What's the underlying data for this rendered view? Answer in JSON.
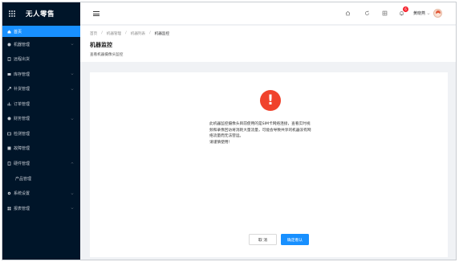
{
  "app": {
    "title": "无人零售"
  },
  "sidebar": {
    "items": [
      {
        "label": "首页",
        "icon": "home-icon",
        "active": true
      },
      {
        "label": "机器管理",
        "icon": "machine-icon",
        "expandable": true
      },
      {
        "label": "远程出货",
        "icon": "shipping-icon"
      },
      {
        "label": "库存管理",
        "icon": "inventory-icon",
        "expandable": true
      },
      {
        "label": "补货管理",
        "icon": "restock-icon",
        "expandable": true
      },
      {
        "label": "订单管理",
        "icon": "order-icon"
      },
      {
        "label": "财务管理",
        "icon": "finance-icon",
        "expandable": true
      },
      {
        "label": "检测管理",
        "icon": "inspect-icon"
      },
      {
        "label": "故障管理",
        "icon": "fault-icon"
      },
      {
        "label": "硬件管理",
        "icon": "hardware-icon",
        "expandable": true,
        "expanded": true
      },
      {
        "label": "产品管理",
        "sub": true
      },
      {
        "label": "系统设置",
        "icon": "settings-icon",
        "expandable": true
      },
      {
        "label": "报表管理",
        "icon": "report-icon",
        "expandable": true
      }
    ]
  },
  "topbar": {
    "notification_count": "6",
    "user_name": "黄晓燕"
  },
  "breadcrumb": [
    "首页",
    "机器管理",
    "机器列表",
    "机器监控"
  ],
  "page": {
    "title": "机器监控",
    "subtitle": "查看机器摄像头监控"
  },
  "dialog": {
    "icon": "!",
    "message_lines": [
      "此机器监控摄像头目前使用的是SIM卡网络连接，查看实时视",
      "频和录像回访将消耗大量流量，可能会导致共享的机器没有网",
      "络流量而无法营运。",
      "请谨慎使用！"
    ],
    "cancel_label": "取 消",
    "confirm_label": "确定看认"
  },
  "colors": {
    "sidebar_bg": "#001529",
    "accent": "#1890ff",
    "warning": "#f0432c",
    "badge": "#f5222d"
  }
}
